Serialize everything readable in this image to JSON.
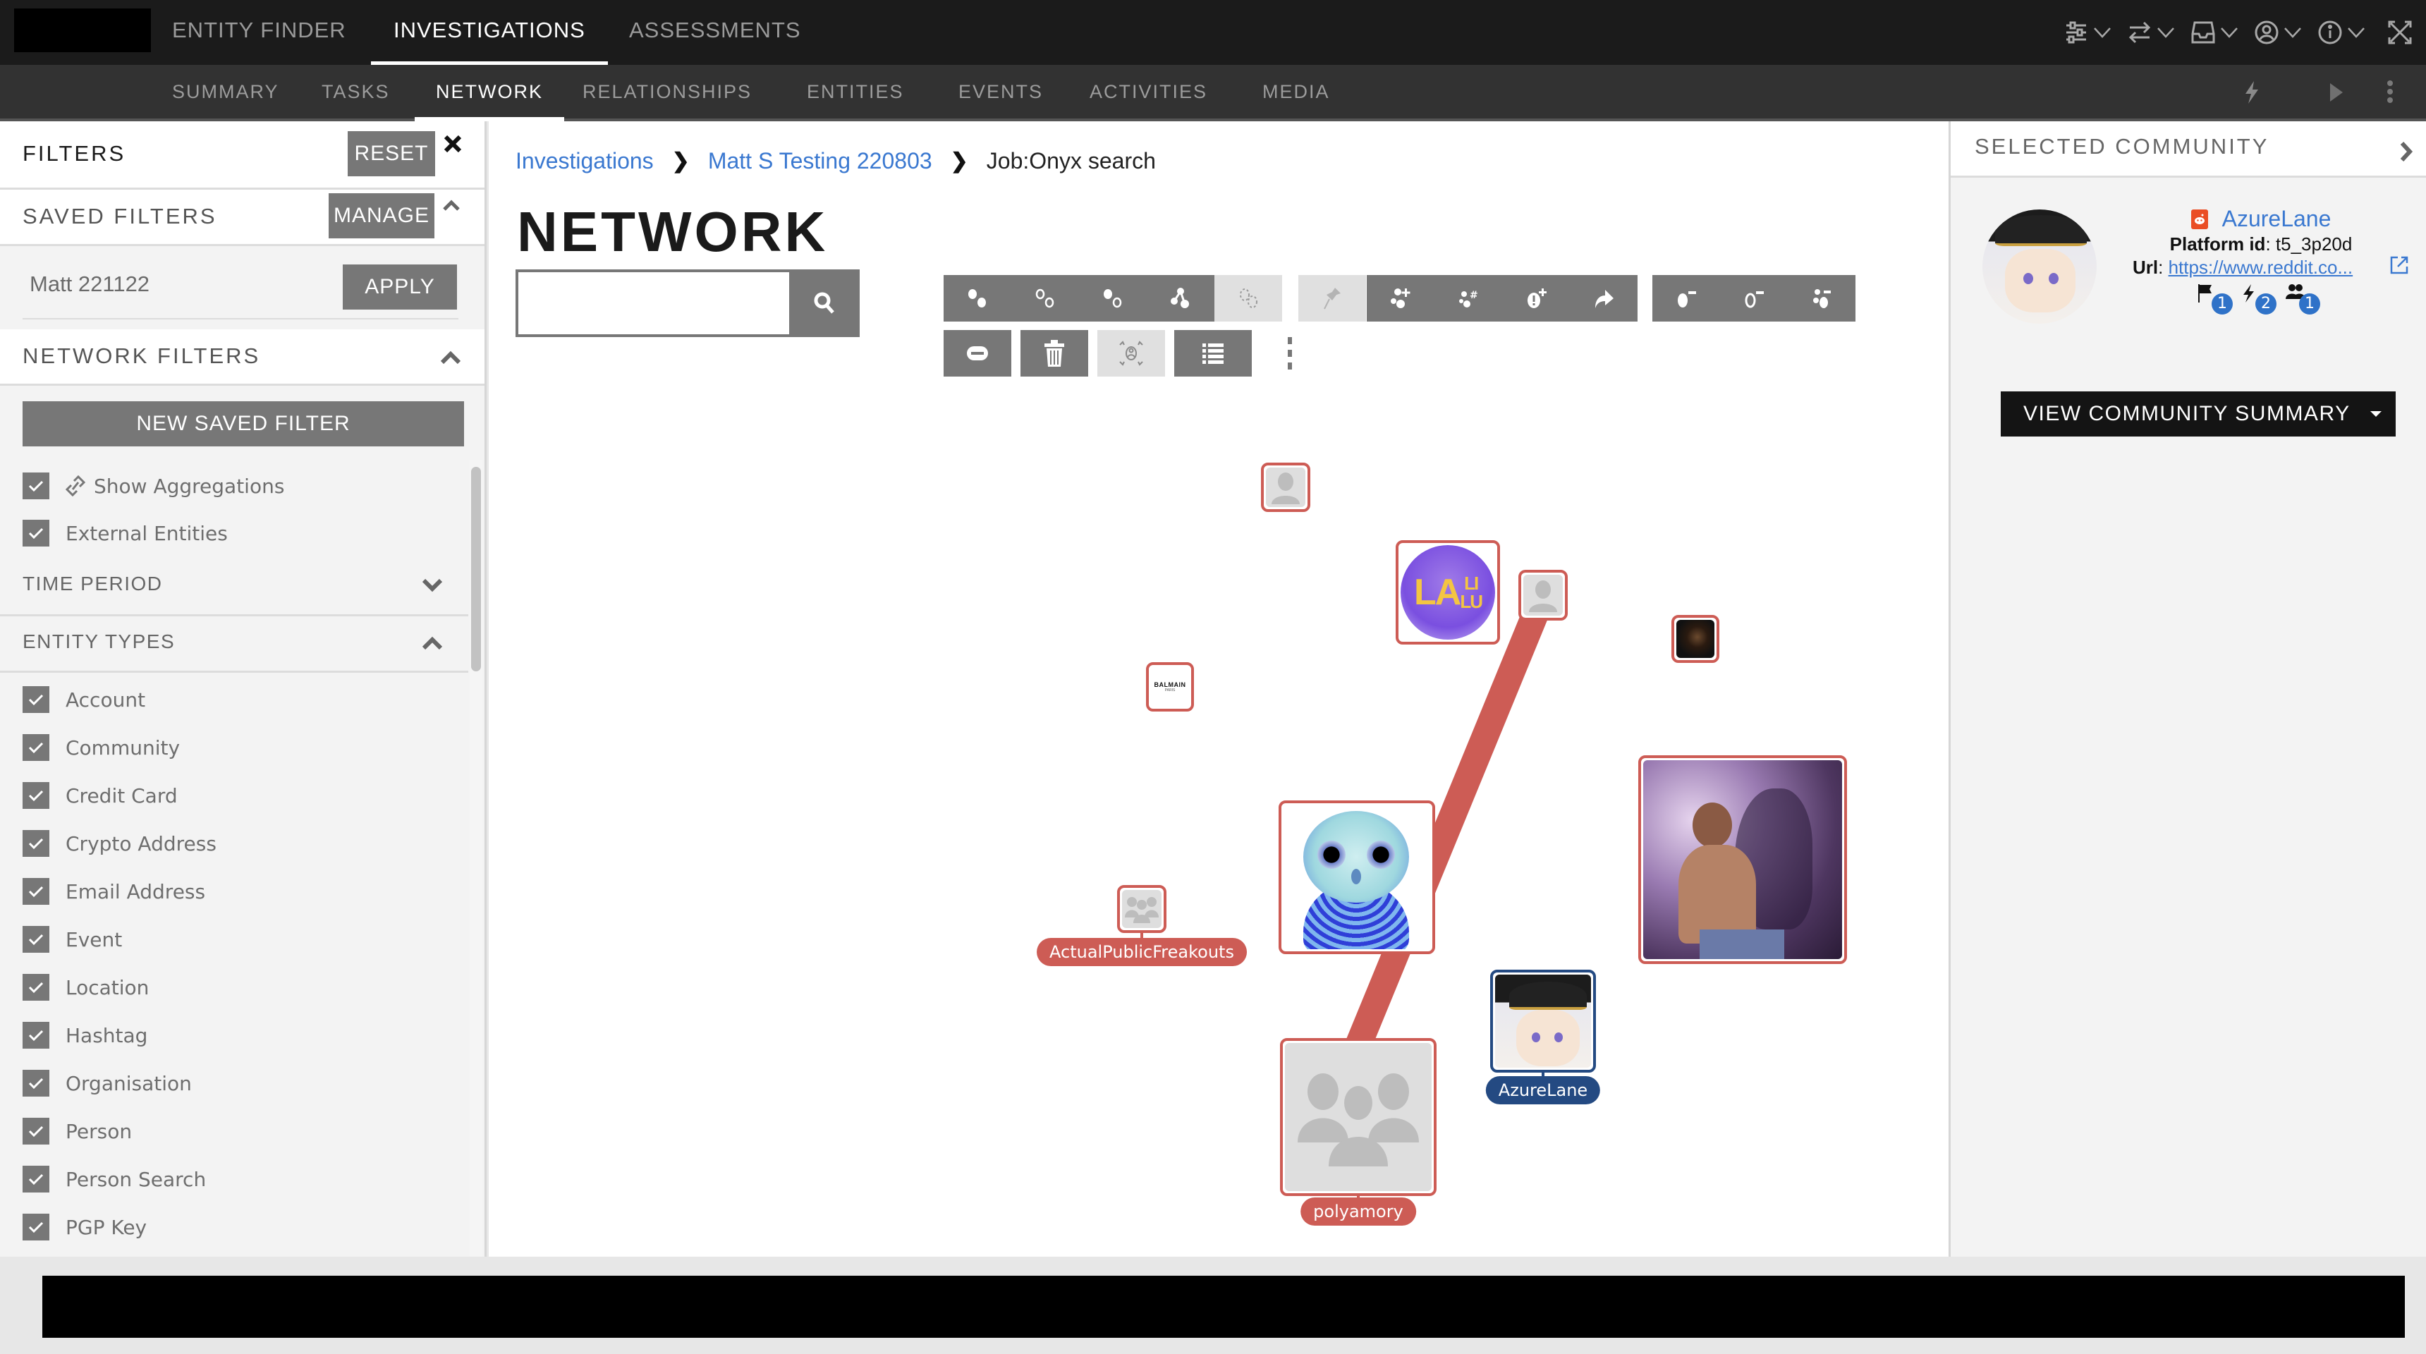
{
  "top_nav": {
    "tabs": [
      {
        "label": "ENTITY FINDER",
        "active": false
      },
      {
        "label": "INVESTIGATIONS",
        "active": true
      },
      {
        "label": "ASSESSMENTS",
        "active": false
      }
    ],
    "icons": [
      "settings-sliders-icon",
      "transfer-icon",
      "inbox-icon",
      "user-account-icon",
      "info-icon",
      "fullscreen-icon"
    ]
  },
  "sub_nav": {
    "tabs": [
      {
        "label": "SUMMARY",
        "active": false
      },
      {
        "label": "TASKS",
        "active": false
      },
      {
        "label": "NETWORK",
        "active": true
      },
      {
        "label": "RELATIONSHIPS",
        "active": false
      },
      {
        "label": "ENTITIES",
        "active": false
      },
      {
        "label": "EVENTS",
        "active": false
      },
      {
        "label": "ACTIVITIES",
        "active": false
      },
      {
        "label": "MEDIA",
        "active": false
      }
    ],
    "icons": [
      "lightning-icon",
      "play-icon",
      "more-vertical-icon"
    ]
  },
  "filters": {
    "title": "FILTERS",
    "reset_label": "RESET",
    "saved_filters": {
      "title": "SAVED FILTERS",
      "manage_label": "MANAGE",
      "selected": "Matt 221122",
      "apply_label": "APPLY"
    },
    "network_filters": {
      "title": "NETWORK FILTERS",
      "new_saved_filter_label": "NEW SAVED FILTER",
      "options": [
        {
          "label": "Show Aggregations",
          "checked": true,
          "icon": "link-icon"
        },
        {
          "label": "External Entities",
          "checked": true
        }
      ],
      "time_period_label": "TIME PERIOD",
      "entity_types_label": "ENTITY TYPES",
      "entity_types": [
        {
          "label": "Account",
          "checked": true
        },
        {
          "label": "Community",
          "checked": true
        },
        {
          "label": "Credit Card",
          "checked": true
        },
        {
          "label": "Crypto Address",
          "checked": true
        },
        {
          "label": "Email Address",
          "checked": true
        },
        {
          "label": "Event",
          "checked": true
        },
        {
          "label": "Location",
          "checked": true
        },
        {
          "label": "Hashtag",
          "checked": true
        },
        {
          "label": "Organisation",
          "checked": true
        },
        {
          "label": "Person",
          "checked": true
        },
        {
          "label": "Person Search",
          "checked": true
        },
        {
          "label": "PGP Key",
          "checked": true
        }
      ]
    }
  },
  "breadcrumb": [
    {
      "label": "Investigations",
      "link": true
    },
    {
      "label": "Matt S Testing 220803",
      "link": true
    },
    {
      "label": "Job:Onyx search",
      "link": false
    }
  ],
  "page_title": "NETWORK",
  "search": {
    "value": "",
    "placeholder": ""
  },
  "toolbar": {
    "row1": [
      {
        "icon": "select-all-nodes-icon",
        "enabled": true
      },
      {
        "icon": "deselect-nodes-icon",
        "enabled": true
      },
      {
        "icon": "invert-selection-icon",
        "enabled": true
      },
      {
        "icon": "select-connected-icon",
        "enabled": true
      },
      {
        "icon": "lasso-select-icon",
        "enabled": false
      },
      {
        "icon": "pin-icon",
        "enabled": false
      },
      {
        "icon": "expand-add-icon",
        "enabled": true
      },
      {
        "icon": "expand-hashtag-icon",
        "enabled": true
      },
      {
        "icon": "add-alert-node-icon",
        "enabled": true
      },
      {
        "icon": "share-forward-icon",
        "enabled": true
      },
      {
        "icon": "remove-selected-icon",
        "enabled": true
      },
      {
        "icon": "remove-unselected-icon",
        "enabled": true
      },
      {
        "icon": "remove-group-icon",
        "enabled": true
      }
    ],
    "row2": [
      {
        "icon": "hide-icon",
        "enabled": true
      },
      {
        "icon": "trash-icon",
        "enabled": true
      },
      {
        "icon": "center-person-icon",
        "enabled": false
      },
      {
        "icon": "list-icon",
        "enabled": true
      }
    ]
  },
  "graph": {
    "nodes": [
      {
        "id": "n1",
        "kind": "person-placeholder",
        "label": ""
      },
      {
        "id": "n2",
        "kind": "image-lalilu",
        "label": ""
      },
      {
        "id": "n3",
        "kind": "person-placeholder",
        "label": ""
      },
      {
        "id": "n4",
        "kind": "image-horse",
        "label": ""
      },
      {
        "id": "n5",
        "kind": "image-balmain",
        "label": "",
        "text": "BALMAIN",
        "subtext": "PARIS"
      },
      {
        "id": "n6",
        "kind": "image-owl",
        "label": ""
      },
      {
        "id": "n7",
        "kind": "image-photo",
        "label": ""
      },
      {
        "id": "n8",
        "kind": "community-placeholder",
        "label": "ActualPublicFreakouts"
      },
      {
        "id": "n9",
        "kind": "image-anime",
        "label": "AzureLane",
        "selected": true
      },
      {
        "id": "n10",
        "kind": "community-placeholder",
        "label": "polyamory"
      }
    ],
    "edges": [
      {
        "from": "n3",
        "to": "n10",
        "color": "#cd5c55"
      }
    ]
  },
  "selected_community": {
    "title": "SELECTED COMMUNITY",
    "name": "AzureLane",
    "platform_icon": "reddit-icon",
    "platform_id_label": "Platform id",
    "platform_id": "t5_3p20d",
    "url_label": "Url",
    "url": "https://www.reddit.co...",
    "stats": [
      {
        "icon": "flag-icon",
        "count": "1"
      },
      {
        "icon": "lightning-icon",
        "count": "2"
      },
      {
        "icon": "users-icon",
        "count": "1"
      }
    ],
    "view_summary_label": "VIEW COMMUNITY SUMMARY"
  },
  "colors": {
    "node_border": "#cd5c55",
    "selected_node": "#244a82",
    "link": "#3a78d0",
    "badge": "#2f72c8",
    "reddit": "#ea4e25"
  }
}
